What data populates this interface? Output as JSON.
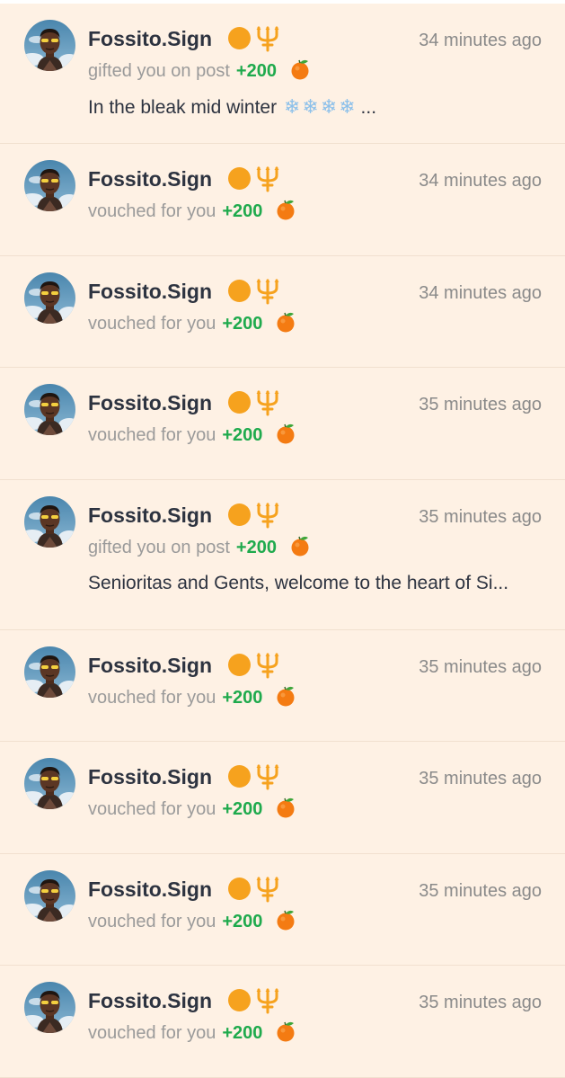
{
  "colors": {
    "background": "#fef1e4",
    "username": "#2d3340",
    "muted_text": "#9a9a9a",
    "timestamp": "#8a8a8a",
    "amount_green": "#1faa4d",
    "badge_orange": "#f6a21e"
  },
  "icons": {
    "badge_circle": "orange-circle-icon",
    "badge_trident": "trident-icon",
    "gift_token": "tangerine-icon",
    "avatar": "user-avatar"
  },
  "notifications": [
    {
      "username": "Fossito.Sign",
      "action": "gifted you on post",
      "amount": "+200",
      "time": "34 minutes ago",
      "preview_text": "In the bleak mid winter",
      "preview_emojis": [
        "❄",
        "❄",
        "❄",
        "❄"
      ],
      "preview_suffix": "..."
    },
    {
      "username": "Fossito.Sign",
      "action": "vouched for you",
      "amount": "+200",
      "time": "34 minutes ago"
    },
    {
      "username": "Fossito.Sign",
      "action": "vouched for you",
      "amount": "+200",
      "time": "34 minutes ago"
    },
    {
      "username": "Fossito.Sign",
      "action": "vouched for you",
      "amount": "+200",
      "time": "35 minutes ago"
    },
    {
      "username": "Fossito.Sign",
      "action": "gifted you on post",
      "amount": "+200",
      "time": "35 minutes ago",
      "preview_text": "Senioritas and Gents, welcome to the heart of Si..."
    },
    {
      "username": "Fossito.Sign",
      "action": "vouched for you",
      "amount": "+200",
      "time": "35 minutes ago"
    },
    {
      "username": "Fossito.Sign",
      "action": "vouched for you",
      "amount": "+200",
      "time": "35 minutes ago"
    },
    {
      "username": "Fossito.Sign",
      "action": "vouched for you",
      "amount": "+200",
      "time": "35 minutes ago"
    },
    {
      "username": "Fossito.Sign",
      "action": "vouched for you",
      "amount": "+200",
      "time": "35 minutes ago"
    }
  ]
}
